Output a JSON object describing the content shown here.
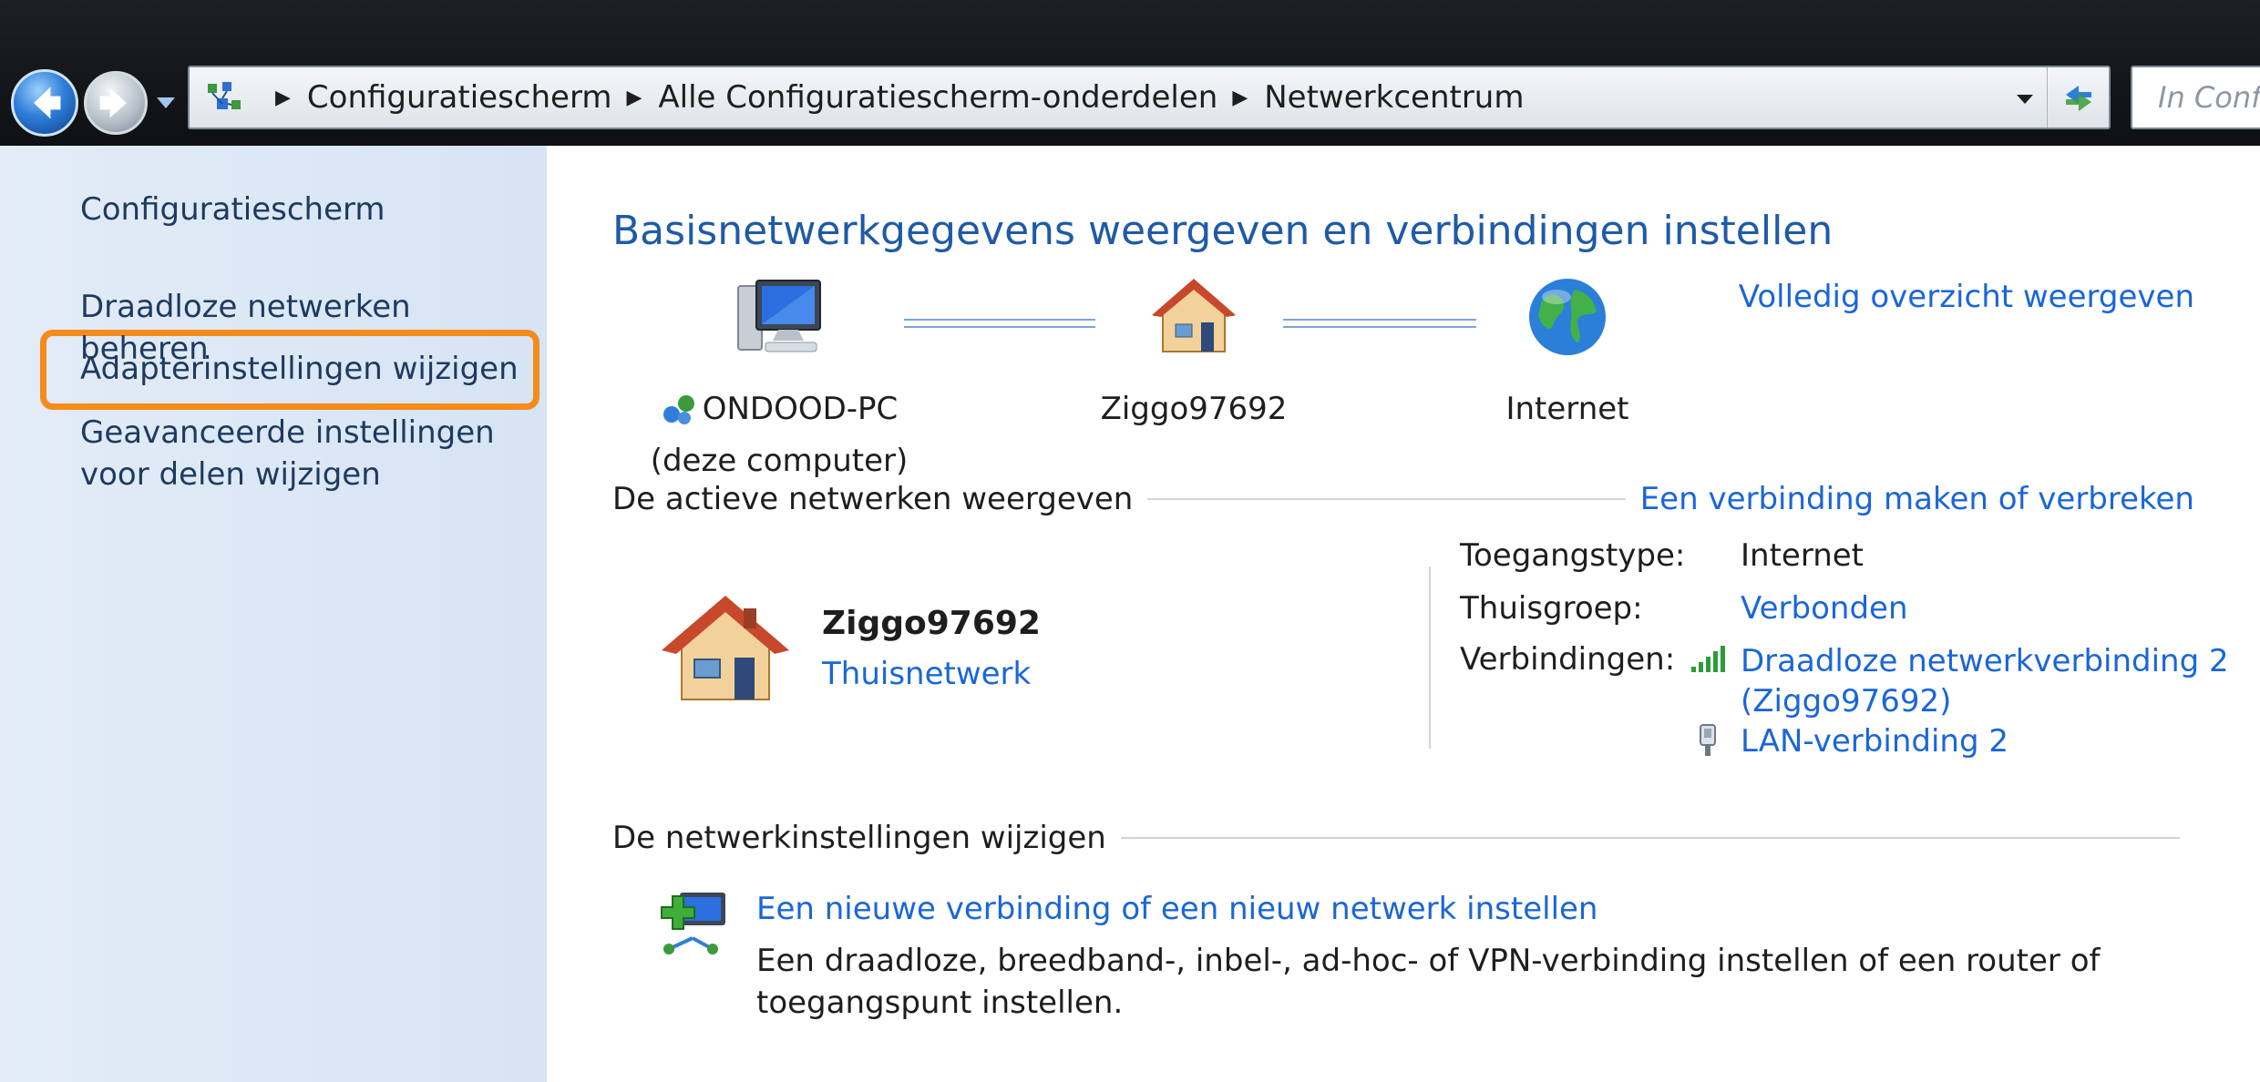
{
  "address_bar": {
    "crumbs": [
      "Configuratiescherm",
      "Alle Configuratiescherm-onderdelen",
      "Netwerkcentrum"
    ],
    "search_placeholder": "In Conf"
  },
  "sidebar": {
    "home": "Configuratiescherm",
    "links": [
      "Draadloze netwerken beheren",
      "Adapterinstellingen wijzigen",
      "Geavanceerde instellingen voor delen wijzigen"
    ],
    "highlight_color": "#f48b1b"
  },
  "main": {
    "title": "Basisnetwerkgegevens weergeven en verbindingen instellen",
    "full_map_link": "Volledig overzicht weergeven",
    "network_map": {
      "computer_name": "ONDOOD-PC",
      "computer_sub": "(deze computer)",
      "router_name": "Ziggo97692",
      "internet_label": "Internet"
    },
    "active_section": {
      "heading": "De actieve netwerken weergeven",
      "action_link": "Een verbinding maken of verbreken",
      "network_name": "Ziggo97692",
      "network_type": "Thuisnetwerk",
      "access_type_label": "Toegangstype:",
      "access_type_value": "Internet",
      "homegroup_label": "Thuisgroep:",
      "homegroup_value": "Verbonden",
      "connections_label": "Verbindingen:",
      "connections": [
        {
          "line1": "Draadloze netwerkverbinding 2",
          "line2": "(Ziggo97692)",
          "icon": "wifi-signal-icon"
        },
        {
          "line1": "LAN-verbinding 2",
          "icon": "lan-plug-icon"
        }
      ]
    },
    "settings_section": {
      "heading": "De netwerkinstellingen wijzigen",
      "tasks": [
        {
          "link": "Een nieuwe verbinding of een nieuw netwerk instellen",
          "description": "Een draadloze, breedband-, inbel-, ad-hoc- of VPN-verbinding instellen of een router of toegangspunt instellen.",
          "icon": "new-connection-icon"
        }
      ]
    }
  },
  "colors": {
    "link": "#1a66d9",
    "title": "#1e5aa8",
    "sidebar_bg": "#dde8f5"
  }
}
